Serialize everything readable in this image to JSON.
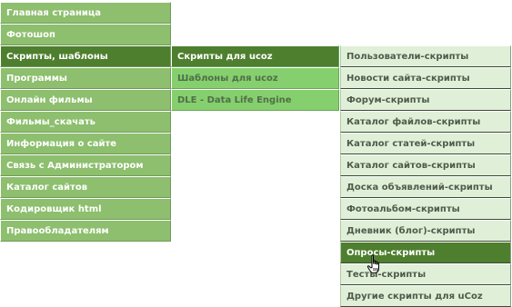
{
  "main_menu": {
    "items": [
      {
        "label": "Главная страница"
      },
      {
        "label": "Фотошоп"
      },
      {
        "label": "Скрипты, шаблоны"
      },
      {
        "label": "Программы"
      },
      {
        "label": "Онлайн фильмы"
      },
      {
        "label": "Фильмы_скачать"
      },
      {
        "label": "Информация о сайте"
      },
      {
        "label": "Связь с Администратором"
      },
      {
        "label": "Каталог сайтов"
      },
      {
        "label": "Кодировщик html"
      },
      {
        "label": "Правообладателям"
      }
    ]
  },
  "sub_menu": {
    "items": [
      {
        "label": "Скрипты для ucoz"
      },
      {
        "label": "Шаблоны для ucoz"
      },
      {
        "label": "DLE - Data Life Engine"
      }
    ]
  },
  "scripts_menu": {
    "items": [
      {
        "label": "Пользователи-скрипты"
      },
      {
        "label": "Новости сайта-скрипты"
      },
      {
        "label": "Форум-скрипты"
      },
      {
        "label": "Каталог файлов-скрипты"
      },
      {
        "label": "Каталог статей-скрипты"
      },
      {
        "label": "Каталог сайтов-скрипты"
      },
      {
        "label": "Доска объявлений-скрипты"
      },
      {
        "label": "Фотоальбом-скрипты"
      },
      {
        "label": "Дневник (блог)-скрипты"
      },
      {
        "label": "Опросы-скрипты"
      },
      {
        "label": "Тесты-скрипты"
      },
      {
        "label": "Другие скрипты для uCoz"
      }
    ]
  },
  "icons": {
    "cursor": "hand-pointer-icon"
  },
  "colors": {
    "main_bg": "#8dbf6e",
    "active_bg": "#4e7f2e",
    "sub_bg": "#86cf6e",
    "scripts_bg": "#e0f0d8"
  }
}
